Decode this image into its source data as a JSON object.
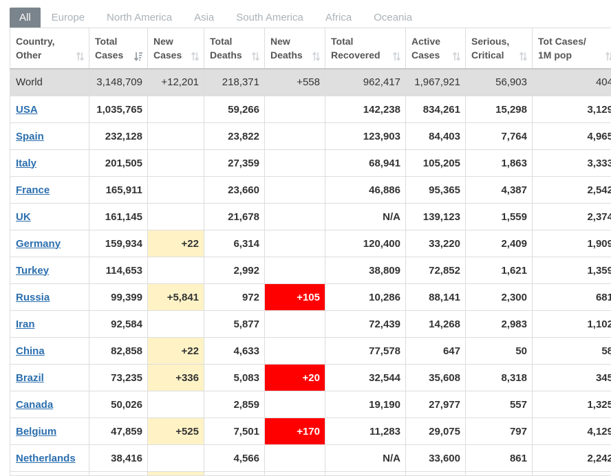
{
  "tabs": [
    {
      "label": "All",
      "active": true
    },
    {
      "label": "Europe",
      "active": false
    },
    {
      "label": "North America",
      "active": false
    },
    {
      "label": "Asia",
      "active": false
    },
    {
      "label": "South America",
      "active": false
    },
    {
      "label": "Africa",
      "active": false
    },
    {
      "label": "Oceania",
      "active": false
    }
  ],
  "table": {
    "headers": [
      "Country,\nOther",
      "Total\nCases",
      "New\nCases",
      "Total\nDeaths",
      "New\nDeaths",
      "Total\nRecovered",
      "Active\nCases",
      "Serious,\nCritical",
      "Tot Cases/\n1M pop"
    ],
    "sorted_column": "Total Cases",
    "highlight_colors": {
      "new_cases": "#fff3c6",
      "new_deaths": "#ff0000",
      "link": "#2b6fae",
      "world_row": "#dfdfdf",
      "active_tab": "#7a848c"
    },
    "world": {
      "country": "World",
      "total_cases": "3,148,709",
      "new_cases": "+12,201",
      "total_deaths": "218,371",
      "new_deaths": "+558",
      "total_recovered": "962,417",
      "active_cases": "1,967,921",
      "serious_critical": "56,903",
      "tot_cases_1m": "404"
    },
    "rows": [
      {
        "country": "USA",
        "total_cases": "1,035,765",
        "new_cases": "",
        "total_deaths": "59,266",
        "new_deaths": "",
        "total_recovered": "142,238",
        "active_cases": "834,261",
        "serious_critical": "15,298",
        "tot_cases_1m": "3,129"
      },
      {
        "country": "Spain",
        "total_cases": "232,128",
        "new_cases": "",
        "total_deaths": "23,822",
        "new_deaths": "",
        "total_recovered": "123,903",
        "active_cases": "84,403",
        "serious_critical": "7,764",
        "tot_cases_1m": "4,965"
      },
      {
        "country": "Italy",
        "total_cases": "201,505",
        "new_cases": "",
        "total_deaths": "27,359",
        "new_deaths": "",
        "total_recovered": "68,941",
        "active_cases": "105,205",
        "serious_critical": "1,863",
        "tot_cases_1m": "3,333"
      },
      {
        "country": "France",
        "total_cases": "165,911",
        "new_cases": "",
        "total_deaths": "23,660",
        "new_deaths": "",
        "total_recovered": "46,886",
        "active_cases": "95,365",
        "serious_critical": "4,387",
        "tot_cases_1m": "2,542"
      },
      {
        "country": "UK",
        "total_cases": "161,145",
        "new_cases": "",
        "total_deaths": "21,678",
        "new_deaths": "",
        "total_recovered": "N/A",
        "active_cases": "139,123",
        "serious_critical": "1,559",
        "tot_cases_1m": "2,374"
      },
      {
        "country": "Germany",
        "total_cases": "159,934",
        "new_cases": "+22",
        "total_deaths": "6,314",
        "new_deaths": "",
        "total_recovered": "120,400",
        "active_cases": "33,220",
        "serious_critical": "2,409",
        "tot_cases_1m": "1,909"
      },
      {
        "country": "Turkey",
        "total_cases": "114,653",
        "new_cases": "",
        "total_deaths": "2,992",
        "new_deaths": "",
        "total_recovered": "38,809",
        "active_cases": "72,852",
        "serious_critical": "1,621",
        "tot_cases_1m": "1,359"
      },
      {
        "country": "Russia",
        "total_cases": "99,399",
        "new_cases": "+5,841",
        "total_deaths": "972",
        "new_deaths": "+105",
        "total_recovered": "10,286",
        "active_cases": "88,141",
        "serious_critical": "2,300",
        "tot_cases_1m": "681"
      },
      {
        "country": "Iran",
        "total_cases": "92,584",
        "new_cases": "",
        "total_deaths": "5,877",
        "new_deaths": "",
        "total_recovered": "72,439",
        "active_cases": "14,268",
        "serious_critical": "2,983",
        "tot_cases_1m": "1,102"
      },
      {
        "country": "China",
        "total_cases": "82,858",
        "new_cases": "+22",
        "total_deaths": "4,633",
        "new_deaths": "",
        "total_recovered": "77,578",
        "active_cases": "647",
        "serious_critical": "50",
        "tot_cases_1m": "58"
      },
      {
        "country": "Brazil",
        "total_cases": "73,235",
        "new_cases": "+336",
        "total_deaths": "5,083",
        "new_deaths": "+20",
        "total_recovered": "32,544",
        "active_cases": "35,608",
        "serious_critical": "8,318",
        "tot_cases_1m": "345"
      },
      {
        "country": "Canada",
        "total_cases": "50,026",
        "new_cases": "",
        "total_deaths": "2,859",
        "new_deaths": "",
        "total_recovered": "19,190",
        "active_cases": "27,977",
        "serious_critical": "557",
        "tot_cases_1m": "1,325"
      },
      {
        "country": "Belgium",
        "total_cases": "47,859",
        "new_cases": "+525",
        "total_deaths": "7,501",
        "new_deaths": "+170",
        "total_recovered": "11,283",
        "active_cases": "29,075",
        "serious_critical": "797",
        "tot_cases_1m": "4,129"
      },
      {
        "country": "Netherlands",
        "total_cases": "38,416",
        "new_cases": "",
        "total_deaths": "4,566",
        "new_deaths": "",
        "total_recovered": "N/A",
        "active_cases": "33,600",
        "serious_critical": "861",
        "tot_cases_1m": "2,242"
      }
    ]
  }
}
